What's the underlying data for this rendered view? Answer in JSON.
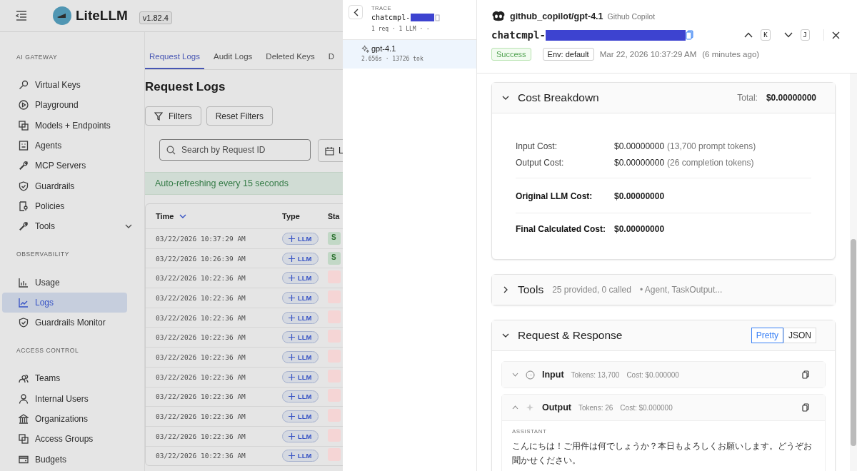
{
  "app": {
    "brand": "LiteLLM",
    "version": "v1.82.4"
  },
  "sidebar": {
    "sections": [
      {
        "title": "AI GATEWAY",
        "items": [
          {
            "label": "Virtual Keys",
            "selected": false
          },
          {
            "label": "Playground",
            "selected": false
          },
          {
            "label": "Models + Endpoints",
            "selected": false
          },
          {
            "label": "Agents",
            "selected": false
          },
          {
            "label": "MCP Servers",
            "selected": false
          },
          {
            "label": "Guardrails",
            "selected": false
          },
          {
            "label": "Policies",
            "selected": false
          },
          {
            "label": "Tools",
            "selected": false,
            "has_children": true
          }
        ]
      },
      {
        "title": "OBSERVABILITY",
        "items": [
          {
            "label": "Usage",
            "selected": false
          },
          {
            "label": "Logs",
            "selected": true
          },
          {
            "label": "Guardrails Monitor",
            "selected": false
          }
        ]
      },
      {
        "title": "ACCESS CONTROL",
        "items": [
          {
            "label": "Teams",
            "selected": false
          },
          {
            "label": "Internal Users",
            "selected": false
          },
          {
            "label": "Organizations",
            "selected": false
          },
          {
            "label": "Access Groups",
            "selected": false
          },
          {
            "label": "Budgets",
            "selected": false
          }
        ]
      }
    ]
  },
  "tabs": [
    {
      "label": "Request Logs",
      "selected": true
    },
    {
      "label": "Audit Logs",
      "selected": false
    },
    {
      "label": "Deleted Keys",
      "selected": false
    },
    {
      "label": "D",
      "selected": false
    }
  ],
  "page_title": "Request Logs",
  "filter_buttons": [
    "Filters",
    "Reset Filters"
  ],
  "search": {
    "placeholder": "Search by Request ID"
  },
  "date_field": {
    "value": "L"
  },
  "refresh_banner": "Auto-refreshing every 15 seconds",
  "table": {
    "columns": [
      "Time",
      "Type",
      "Sta"
    ],
    "rows": [
      {
        "time": "03/22/2026 10:37:29 AM",
        "type": "LLM",
        "color": "#c2d8c6",
        "status_text": "S"
      },
      {
        "time": "03/22/2026 10:26:39 AM",
        "type": "LLM",
        "color": "#c2d8c6",
        "status_text": "S"
      },
      {
        "time": "03/22/2026 10:22:36 AM",
        "type": "LLM",
        "color": "#f5d5d5"
      },
      {
        "time": "03/22/2026 10:22:36 AM",
        "type": "LLM",
        "color": "#f5d5d5"
      },
      {
        "time": "03/22/2026 10:22:36 AM",
        "type": "LLM",
        "color": "#f5d5d5"
      },
      {
        "time": "03/22/2026 10:22:36 AM",
        "type": "LLM",
        "color": "#f5d5d5"
      },
      {
        "time": "03/22/2026 10:22:36 AM",
        "type": "LLM",
        "color": "#f5d5d5"
      },
      {
        "time": "03/22/2026 10:22:36 AM",
        "type": "LLM",
        "color": "#f5d5d5"
      },
      {
        "time": "03/22/2026 10:22:36 AM",
        "type": "LLM",
        "color": "#f5d5d5"
      },
      {
        "time": "03/22/2026 10:22:36 AM",
        "type": "LLM",
        "color": "#f5d5d5"
      },
      {
        "time": "03/22/2026 10:22:36 AM",
        "type": "LLM",
        "color": "#f5d5d5"
      },
      {
        "time": "03/22/2026 10:22:36 AM",
        "type": "LLM",
        "color": "#f5d5d5"
      }
    ]
  },
  "trace": {
    "label": "TRACE",
    "id": "chatcmpl-",
    "summary": "1 req · 1 LLM · -",
    "spans": [
      {
        "name": "gpt-4.1",
        "meta": "2.656s · 13726 tok",
        "selected": true
      }
    ]
  },
  "detail": {
    "model": "github_copilot/gpt-4.1",
    "provider": "Github Copilot",
    "request_id": "chatcmpl-",
    "nav_keys": [
      "K",
      "J"
    ],
    "status": "Success",
    "env": "Env: default",
    "timestamp": "Mar 22, 2026 10:37:29 AM",
    "relative_time": "(6 minutes ago)",
    "cost": {
      "title": "Cost Breakdown",
      "expanded": true,
      "total_label": "Total:",
      "total": "$0.00000000",
      "lines": [
        {
          "label": "Input Cost:",
          "value": "$0.00000000",
          "note": "(13,700 prompt tokens)",
          "kind": "plain"
        },
        {
          "label": "Output Cost:",
          "value": "$0.00000000",
          "note": "(26 completion tokens)",
          "kind": "plain"
        },
        {
          "label": "Original LLM Cost:",
          "value": "$0.00000000",
          "kind": "subtotal"
        },
        {
          "label": "Final Calculated Cost:",
          "value": "$0.00000000",
          "kind": "final"
        }
      ]
    },
    "tools": {
      "title": "Tools",
      "expanded": false,
      "summary": "25 provided, 0 called",
      "names": "• Agent, TaskOutput..."
    },
    "request_response": {
      "title": "Request & Response",
      "expanded": true,
      "views": [
        {
          "label": "Pretty",
          "selected": true
        },
        {
          "label": "JSON",
          "selected": false
        }
      ],
      "messages": [
        {
          "title": "Input",
          "kind": "input",
          "expanded": false,
          "tokens": "Tokens: 13,700",
          "cost": "Cost: $0.000000"
        },
        {
          "title": "Output",
          "kind": "output",
          "expanded": true,
          "tokens": "Tokens: 26",
          "cost": "Cost: $0.000000",
          "role": "ASSISTANT",
          "text": "こんにちは！ご用件は何でしょうか？本日もよろしくお願いします。どうぞお聞かせください。"
        }
      ]
    }
  }
}
